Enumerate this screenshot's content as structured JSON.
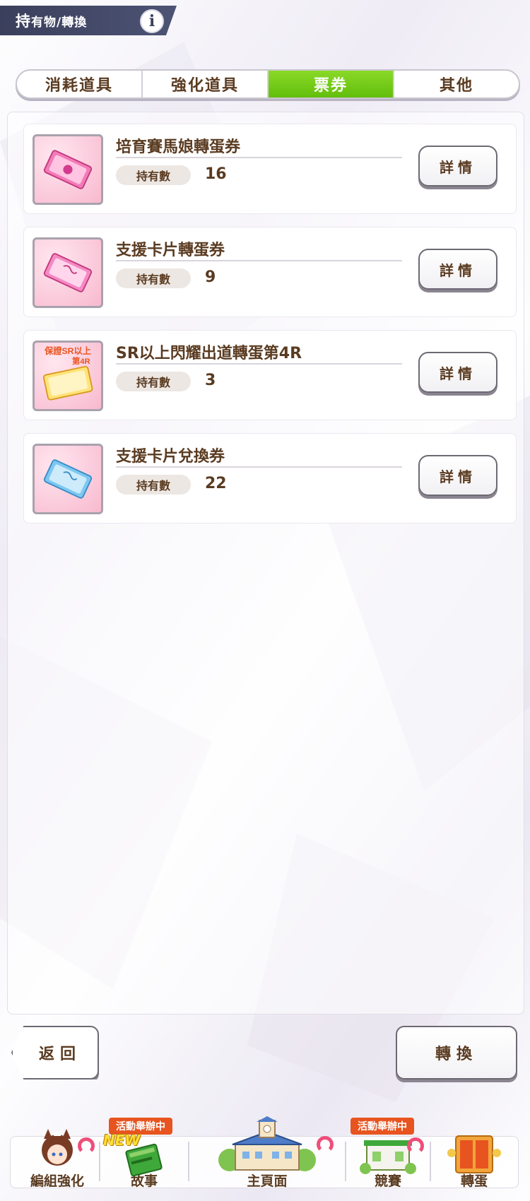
{
  "header": {
    "title_main": "持",
    "title_rest": "有物/轉換",
    "info_glyph": "i"
  },
  "tabs": [
    {
      "label": "消耗道具",
      "active": false
    },
    {
      "label": "強化道具",
      "active": false
    },
    {
      "label": "票券",
      "active": true
    },
    {
      "label": "其他",
      "active": false
    }
  ],
  "items": [
    {
      "name": "培育賽馬娘轉蛋券",
      "qty_label": "持有數",
      "qty": "16",
      "detail": "詳情"
    },
    {
      "name": "支援卡片轉蛋券",
      "qty_label": "持有數",
      "qty": "9",
      "detail": "詳情"
    },
    {
      "name": "SR以上閃耀出道轉蛋第4R",
      "qty_label": "持有數",
      "qty": "3",
      "detail": "詳情",
      "thumb_text": [
        "保證SR以上",
        "第4R"
      ]
    },
    {
      "name": "支援卡片兌換券",
      "qty_label": "持有數",
      "qty": "22",
      "detail": "詳情"
    }
  ],
  "buttons": {
    "back": "返回",
    "convert": "轉換"
  },
  "nav": {
    "items": [
      {
        "label": "編組強化"
      },
      {
        "label": "故事",
        "badge": "活動舉辦中",
        "new": "NEW"
      },
      {
        "label": "主頁面"
      },
      {
        "label": "競賽",
        "badge": "活動舉辦中"
      },
      {
        "label": "轉蛋"
      }
    ]
  },
  "colors": {
    "active_tab": "#6fcb12",
    "text_brown": "#5a3b21",
    "header_bg": "#3a3f5c",
    "event_badge": "#e8541f"
  }
}
